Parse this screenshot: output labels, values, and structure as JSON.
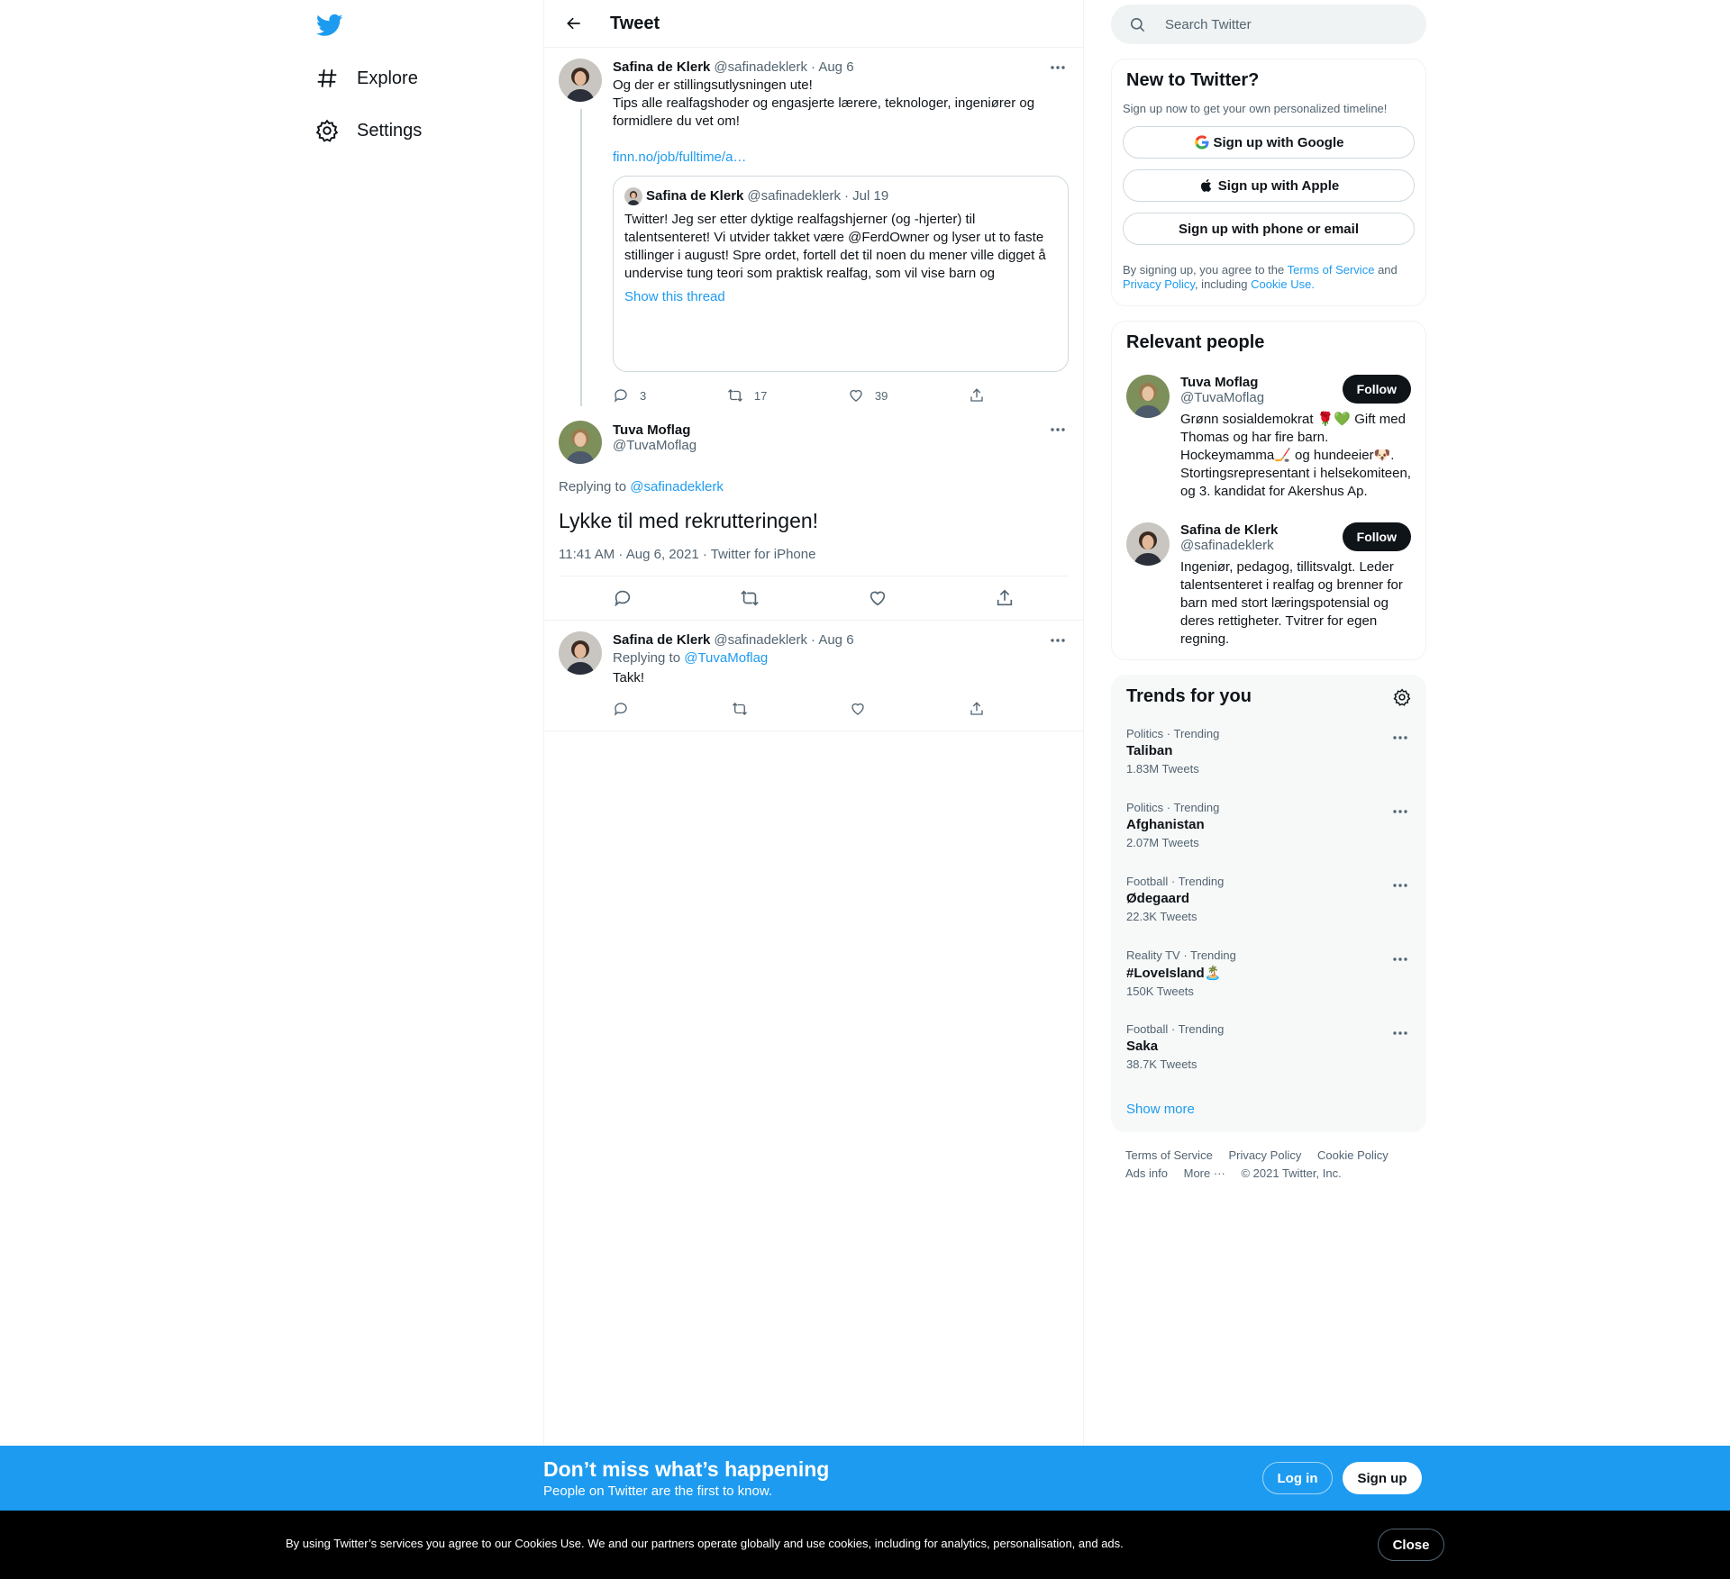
{
  "nav": {
    "explore": "Explore",
    "settings": "Settings"
  },
  "header": {
    "title": "Tweet"
  },
  "thread_tweet": {
    "name": "Safina de Klerk",
    "handle": "@safinadeklerk",
    "date": "· Aug 6",
    "line1": "Og der er stillingsutlysningen ute!",
    "line2": "Tips alle realfagshoder og engasjerte lærere, teknologer, ingeniører og formidlere du vet om!",
    "link": "finn.no/job/fulltime/a…",
    "quote": {
      "name": "Safina de Klerk",
      "handle": "@safinadeklerk",
      "date": "· Jul 19",
      "text": "Twitter! Jeg ser etter dyktige realfagshjerner (og -hjerter) til talentsenteret! Vi utvider takket være @FerdOwner og lyser ut to faste stillinger i august! Spre ordet, fortell det til noen du mener ville digget å undervise tung teori som praktisk realfag, som vil vise barn og",
      "show_thread": "Show this thread"
    },
    "replies": "3",
    "retweets": "17",
    "likes": "39"
  },
  "focus_tweet": {
    "name": "Tuva Moflag",
    "handle": "@TuvaMoflag",
    "replying_prefix": "Replying to",
    "replying_to": "@safinadeklerk",
    "text": "Lykke til med rekrutteringen!",
    "meta": "11:41 AM · Aug 6, 2021 · Twitter for iPhone"
  },
  "reply_tweet": {
    "name": "Safina de Klerk",
    "handle": "@safinadeklerk",
    "date": "· Aug 6",
    "replying_prefix": "Replying to",
    "replying_to": "@TuvaMoflag",
    "text": "Takk!"
  },
  "search": {
    "placeholder": "Search Twitter"
  },
  "signup_card": {
    "title": "New to Twitter?",
    "subtitle": "Sign up now to get your own personalized timeline!",
    "google": "Sign up with Google",
    "apple": "Sign up with Apple",
    "phone": "Sign up with phone or email",
    "legal_1": "By signing up, you agree to the",
    "tos": "Terms of Service",
    "legal_2": "and",
    "privacy": "Privacy Policy",
    "legal_3": ", including",
    "cookie": "Cookie Use."
  },
  "relevant": {
    "title": "Relevant people",
    "follow_label": "Follow",
    "people": [
      {
        "name": "Tuva Moflag",
        "handle": "@TuvaMoflag",
        "bio": "Grønn sosialdemokrat 🌹💚 Gift med Thomas og har fire barn. Hockeymamma🏒 og hundeeier🐶. Stortingsrepresentant i helsekomiteen, og 3. kandidat for Akershus Ap."
      },
      {
        "name": "Safina de Klerk",
        "handle": "@safinadeklerk",
        "bio": "Ingeniør, pedagog, tillitsvalgt. Leder talentsenteret i realfag og brenner for barn med stort læringspotensial og deres rettigheter. Tvitrer for egen regning."
      }
    ]
  },
  "trends": {
    "title": "Trends for you",
    "items": [
      {
        "category": "Politics · Trending",
        "name": "Taliban",
        "count": "1.83M Tweets"
      },
      {
        "category": "Politics · Trending",
        "name": "Afghanistan",
        "count": "2.07M Tweets"
      },
      {
        "category": "Football · Trending",
        "name": "Ødegaard",
        "count": "22.3K Tweets"
      },
      {
        "category": "Reality TV · Trending",
        "name": "#LoveIsland🏝️",
        "count": "150K Tweets"
      },
      {
        "category": "Football · Trending",
        "name": "Saka",
        "count": "38.7K Tweets"
      }
    ],
    "show_more": "Show more"
  },
  "footer": {
    "tos": "Terms of Service",
    "privacy": "Privacy Policy",
    "cookie": "Cookie Policy",
    "ads": "Ads info",
    "more": "More ···",
    "copyright": "© 2021 Twitter, Inc."
  },
  "bluebar": {
    "title": "Don’t miss what’s happening",
    "subtitle": "People on Twitter are the first to know.",
    "login": "Log in",
    "signup": "Sign up"
  },
  "cookiebar": {
    "text": "By using Twitter’s services you agree to our Cookies Use. We and our partners operate globally and use cookies, including for analytics, personalisation, and ads.",
    "close": "Close"
  },
  "colors": {
    "accent": "#1d9bf0",
    "text": "#0f1419",
    "muted": "#536471",
    "border": "#eff3f4"
  }
}
